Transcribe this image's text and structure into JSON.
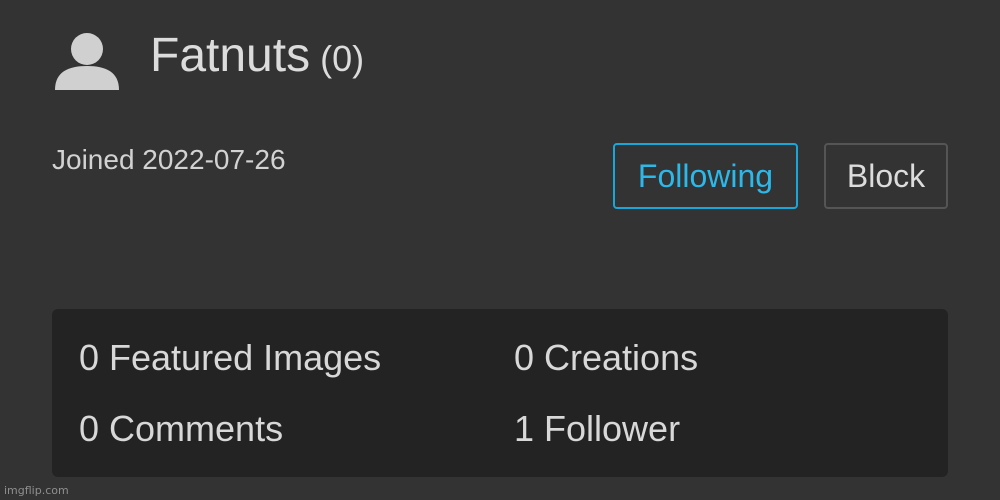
{
  "profile": {
    "username": "Fatnuts",
    "points": "(0)",
    "joined": "Joined 2022-07-26",
    "avatar_icon": "user-silhouette-icon"
  },
  "actions": {
    "following_label": "Following",
    "block_label": "Block"
  },
  "stats": {
    "featured_images": "0 Featured Images",
    "creations": "0 Creations",
    "comments": "0 Comments",
    "followers": "1 Follower"
  },
  "watermark": "imgflip.com",
  "colors": {
    "background": "#333333",
    "stats_panel": "#232323",
    "accent": "#17a8d9"
  }
}
